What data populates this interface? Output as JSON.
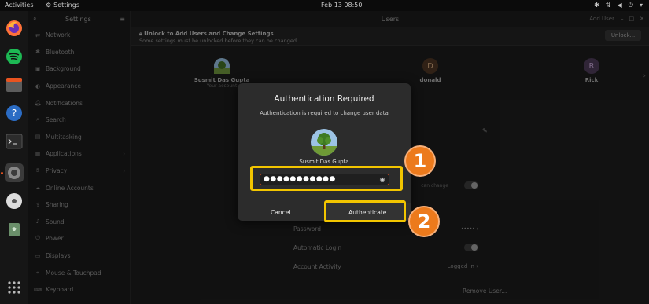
{
  "topbar": {
    "activities": "Activities",
    "app_name": "Settings",
    "clock": "Feb 13  08:50"
  },
  "sidebar": {
    "title": "Settings",
    "items": [
      {
        "label": "Network",
        "icon": "network-icon"
      },
      {
        "label": "Bluetooth",
        "icon": "bluetooth-icon"
      },
      {
        "label": "Background",
        "icon": "background-icon"
      },
      {
        "label": "Appearance",
        "icon": "appearance-icon"
      },
      {
        "label": "Notifications",
        "icon": "bell-icon"
      },
      {
        "label": "Search",
        "icon": "search-icon"
      },
      {
        "label": "Multitasking",
        "icon": "multitasking-icon"
      },
      {
        "label": "Applications",
        "icon": "apps-icon",
        "chevron": true
      },
      {
        "label": "Privacy",
        "icon": "hand-icon",
        "chevron": true
      },
      {
        "label": "Online Accounts",
        "icon": "cloud-icon"
      },
      {
        "label": "Sharing",
        "icon": "share-icon"
      },
      {
        "label": "Sound",
        "icon": "speaker-icon"
      },
      {
        "label": "Power",
        "icon": "power-icon"
      },
      {
        "label": "Displays",
        "icon": "display-icon"
      },
      {
        "label": "Mouse & Touchpad",
        "icon": "mouse-icon"
      },
      {
        "label": "Keyboard",
        "icon": "keyboard-icon"
      }
    ]
  },
  "main": {
    "title": "Users",
    "add_user": "Add User...",
    "banner_title": "Unlock to Add Users and Change Settings",
    "banner_sub": "Some settings must be unlocked before they can be changed.",
    "unlock_label": "Unlock...",
    "users": [
      {
        "name": "Susmit Das Gupta",
        "sub": "Your account",
        "initial": ""
      },
      {
        "name": "donald",
        "sub": "",
        "initial": "D"
      },
      {
        "name": "Rick",
        "sub": "",
        "initial": "R"
      }
    ],
    "rows": {
      "partial_label": "can change",
      "password_label": "Password",
      "password_value": "•••••",
      "autologin_label": "Automatic Login",
      "activity_label": "Account Activity",
      "activity_value": "Logged in",
      "remove_label": "Remove User..."
    }
  },
  "dialog": {
    "title": "Authentication Required",
    "message": "Authentication is required to change user data",
    "user": "Susmit Das Gupta",
    "password_mask": "●●●●●●●●●●●",
    "cancel_label": "Cancel",
    "auth_label": "Authenticate"
  },
  "annotations": {
    "badge1": "1",
    "badge2": "2",
    "highlight_color": "#f2c500",
    "badge_color": "#ec7a1c"
  },
  "colors": {
    "accent": "#e95420"
  }
}
